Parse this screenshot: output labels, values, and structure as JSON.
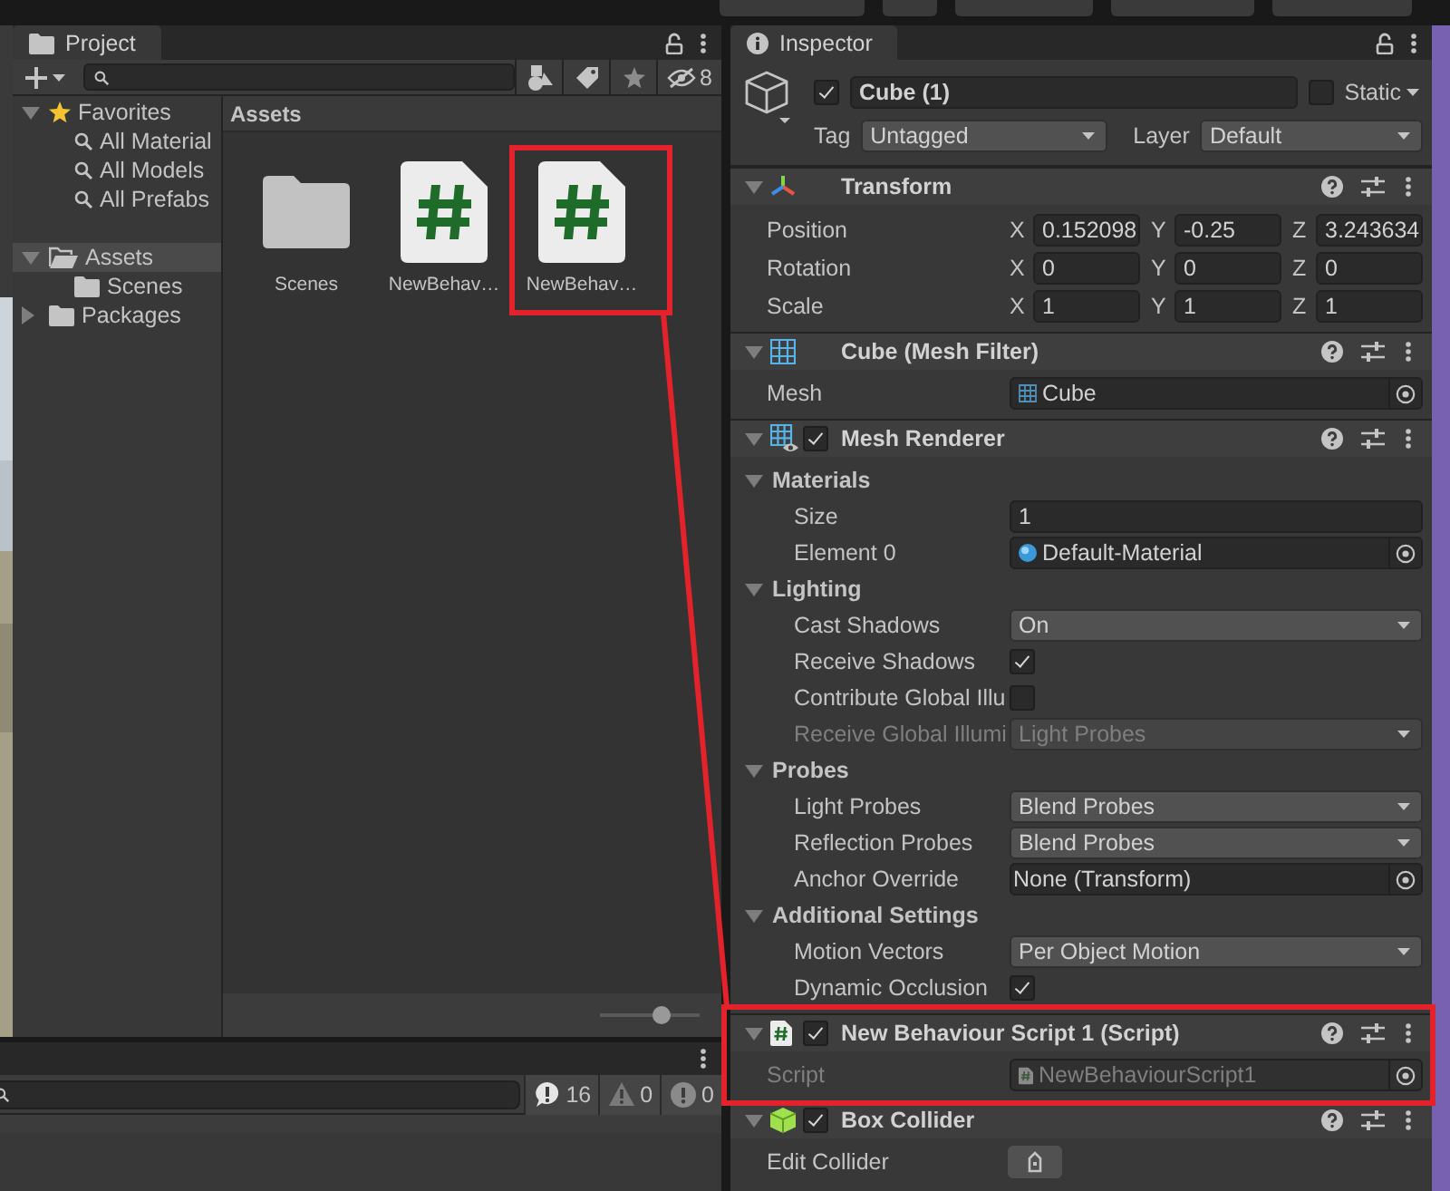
{
  "project": {
    "tab": "Project",
    "hidden_packages_count": "8",
    "tree": [
      {
        "label": "Favorites",
        "kind": "favorites",
        "expanded": true,
        "selected": false,
        "children": [
          {
            "label": "All Material",
            "kind": "search",
            "selected": false
          },
          {
            "label": "All Models",
            "kind": "search",
            "selected": false
          },
          {
            "label": "All Prefabs",
            "kind": "search",
            "selected": false
          }
        ]
      },
      {
        "label": "Assets",
        "kind": "folder",
        "expanded": true,
        "selected": true,
        "children": [
          {
            "label": "Scenes",
            "kind": "folder",
            "selected": false
          }
        ]
      },
      {
        "label": "Packages",
        "kind": "folder",
        "expanded": false,
        "selected": false
      }
    ],
    "path": "Assets",
    "assets": [
      {
        "name": "Scenes",
        "kind": "folder"
      },
      {
        "name": "NewBehav…",
        "kind": "script"
      },
      {
        "name": "NewBehav…",
        "kind": "script"
      }
    ],
    "icon_size": {
      "level": 0.62
    }
  },
  "console": {
    "filters": [
      {
        "kind": "info",
        "count": "16"
      },
      {
        "kind": "warning",
        "count": "0"
      },
      {
        "kind": "error",
        "count": "0"
      }
    ]
  },
  "inspector": {
    "tab": "Inspector",
    "object": {
      "active": true,
      "name": "Cube (1)",
      "static": false,
      "static_label": "Static",
      "tag_label": "Tag",
      "tag": "Untagged",
      "layer_label": "Layer",
      "layer": "Default"
    },
    "components": [
      {
        "kind": "transform",
        "title": "Transform",
        "expanded": true,
        "fields": [
          {
            "kind": "vector3",
            "label": "Position",
            "disabled": false,
            "axes": [
              {
                "axis": "X",
                "value": "0.152098"
              },
              {
                "axis": "Y",
                "value": "-0.25"
              },
              {
                "axis": "Z",
                "value": "3.243634"
              }
            ]
          },
          {
            "kind": "vector3",
            "label": "Rotation",
            "disabled": false,
            "axes": [
              {
                "axis": "X",
                "value": "0"
              },
              {
                "axis": "Y",
                "value": "0"
              },
              {
                "axis": "Z",
                "value": "0"
              }
            ]
          },
          {
            "kind": "vector3",
            "label": "Scale",
            "disabled": false,
            "axes": [
              {
                "axis": "X",
                "value": "1"
              },
              {
                "axis": "Y",
                "value": "1"
              },
              {
                "axis": "Z",
                "value": "1"
              }
            ]
          }
        ]
      },
      {
        "kind": "mesh-filter",
        "title": "Cube (Mesh Filter)",
        "expanded": true,
        "fields": [
          {
            "kind": "mesh-object",
            "label": "Mesh",
            "value": "Cube",
            "disabled": false
          }
        ]
      },
      {
        "kind": "mesh-renderer",
        "title": "Mesh Renderer",
        "enabled": true,
        "expanded": true,
        "fields": [
          {
            "kind": "section",
            "label": "Materials",
            "expanded": true,
            "children": [
              {
                "kind": "number",
                "label": "Size",
                "value": "1",
                "disabled": false
              },
              {
                "kind": "material-object",
                "label": "Element 0",
                "value": "Default-Material",
                "disabled": false
              }
            ]
          },
          {
            "kind": "section",
            "label": "Lighting",
            "expanded": true,
            "children": [
              {
                "kind": "dropdown",
                "label": "Cast Shadows",
                "value": "On",
                "disabled": false
              },
              {
                "kind": "checkbox",
                "label": "Receive Shadows",
                "checked": true,
                "disabled": false
              },
              {
                "kind": "checkbox",
                "label": "Contribute Global Illu",
                "checked": false,
                "disabled": false
              },
              {
                "kind": "dropdown",
                "label": "Receive Global Illumi",
                "value": "Light Probes",
                "disabled": true
              }
            ]
          },
          {
            "kind": "section",
            "label": "Probes",
            "expanded": true,
            "children": [
              {
                "kind": "dropdown",
                "label": "Light Probes",
                "value": "Blend Probes",
                "disabled": false
              },
              {
                "kind": "dropdown",
                "label": "Reflection Probes",
                "value": "Blend Probes",
                "disabled": false
              },
              {
                "kind": "object",
                "label": "Anchor Override",
                "value": "None (Transform)",
                "disabled": false
              }
            ]
          },
          {
            "kind": "section",
            "label": "Additional Settings",
            "expanded": true,
            "children": [
              {
                "kind": "dropdown",
                "label": "Motion Vectors",
                "value": "Per Object Motion",
                "disabled": false
              },
              {
                "kind": "checkbox",
                "label": "Dynamic Occlusion",
                "checked": true,
                "disabled": false
              }
            ]
          }
        ]
      },
      {
        "kind": "script",
        "title": "New Behaviour Script 1 (Script)",
        "enabled": true,
        "expanded": true,
        "fields": [
          {
            "kind": "script-object",
            "label": "Script",
            "value": "NewBehaviourScript1",
            "disabled": true
          }
        ]
      },
      {
        "kind": "box-collider",
        "title": "Box Collider",
        "enabled": true,
        "expanded": true,
        "fields": [
          {
            "kind": "edit-button",
            "label": "Edit Collider",
            "disabled": false
          }
        ]
      }
    ]
  }
}
